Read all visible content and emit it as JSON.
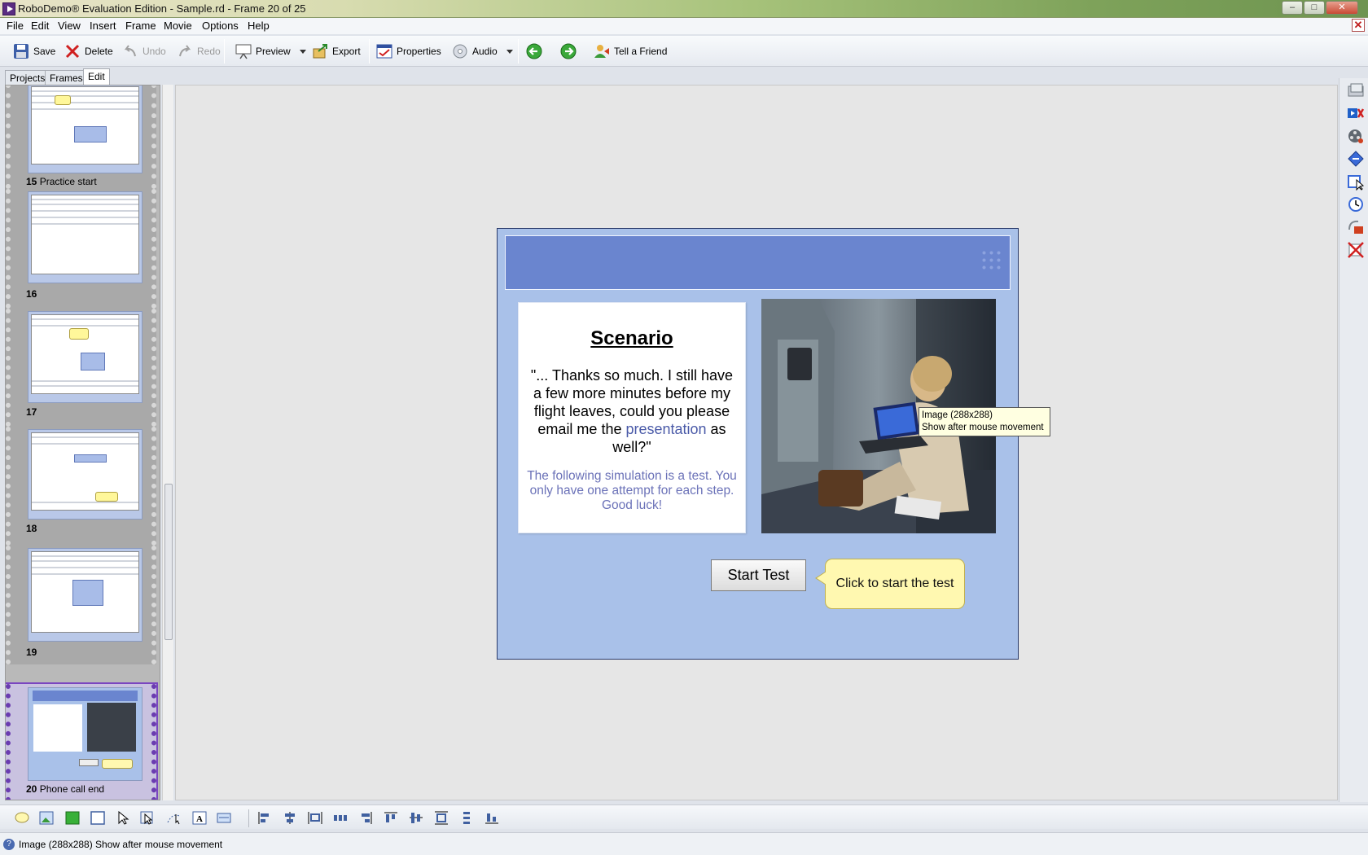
{
  "window": {
    "title": "RoboDemo® Evaluation Edition - Sample.rd - Frame 20 of 25",
    "minimize": "‒",
    "maximize": "□",
    "close": "✕"
  },
  "menu": [
    "File",
    "Edit",
    "View",
    "Insert",
    "Frame",
    "Movie",
    "Options",
    "Help"
  ],
  "mdi_close": "✕",
  "toolbar": {
    "save": "Save",
    "delete": "Delete",
    "undo": "Undo",
    "redo": "Redo",
    "preview": "Preview",
    "export": "Export",
    "properties": "Properties",
    "audio": "Audio",
    "tell_a_friend": "Tell a Friend"
  },
  "tabs": [
    "Projects",
    "Frames",
    "Edit"
  ],
  "active_tab": "Edit",
  "frames": [
    {
      "number": "15",
      "name": "Practice start"
    },
    {
      "number": "16",
      "name": ""
    },
    {
      "number": "17",
      "name": ""
    },
    {
      "number": "18",
      "name": ""
    },
    {
      "number": "19",
      "name": ""
    },
    {
      "number": "20",
      "name": "Phone call end"
    }
  ],
  "selected_frame": "20",
  "slide": {
    "title": "Scenario",
    "quote_part1": "\"... Thanks so much. I still have a few more minutes before my flight leaves, could you please email me the ",
    "quote_highlight": "presentation",
    "quote_part2": " as well?\"",
    "note": "The following simulation is a test. You only have one attempt for each step. Good luck!",
    "start_button": "Start Test",
    "callout": "Click to start the test"
  },
  "tooltip": {
    "line1": "Image (288x288)",
    "line2": "Show after mouse movement"
  },
  "status": {
    "text": "Image (288x288) Show after mouse movement"
  },
  "colors": {
    "slide_background": "#a9c1e9",
    "slide_header": "#6a85cf",
    "callout_fill": "#fff8b0",
    "selection": "#7a46c0"
  }
}
